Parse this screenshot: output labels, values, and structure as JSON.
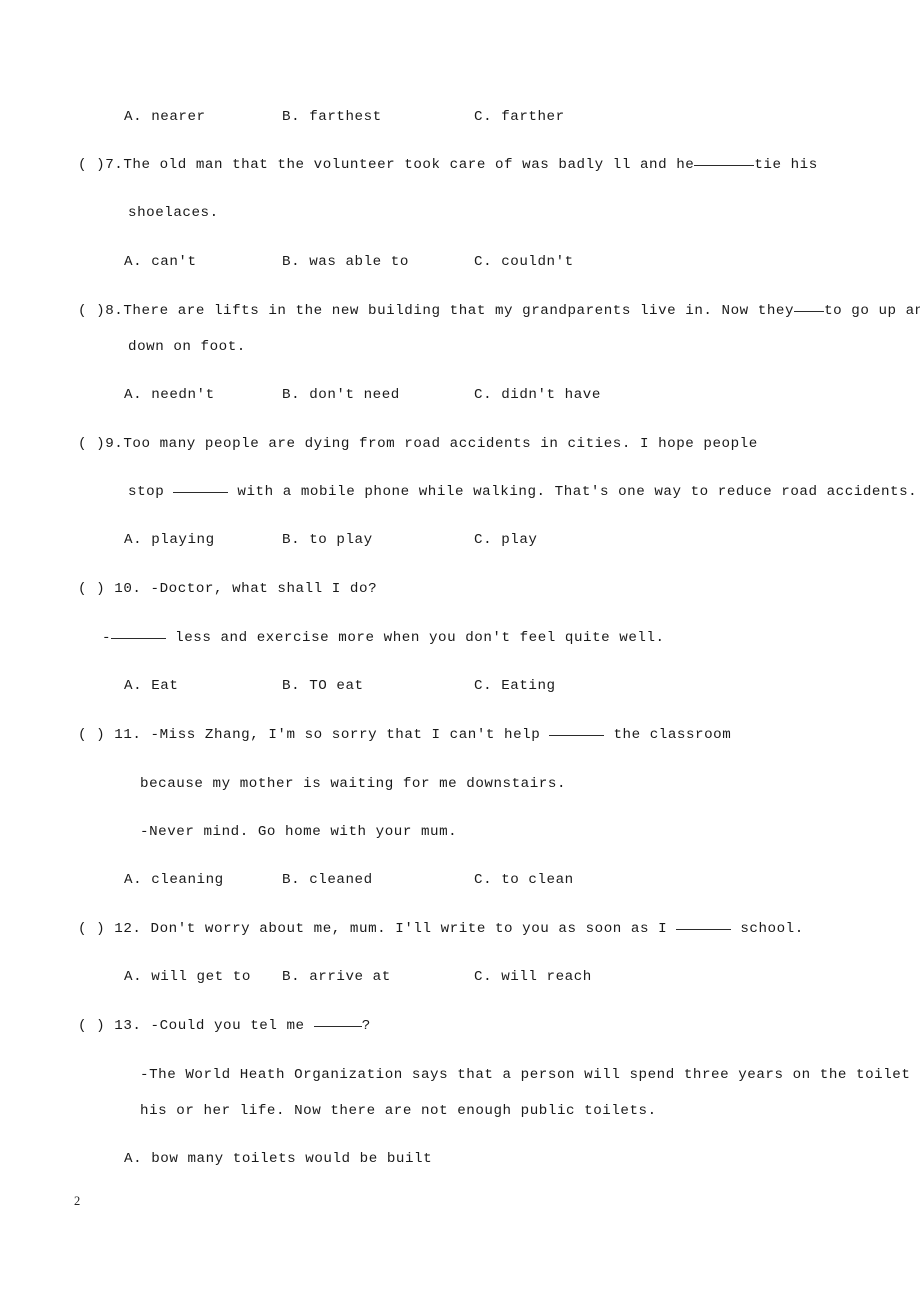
{
  "document": {
    "page_number": "2",
    "type": "english-exam-multiple-choice"
  },
  "orphan_options": {
    "a": "A. nearer",
    "b": "B. farthest",
    "c": "C. farther"
  },
  "questions": [
    {
      "marker": "(  )7.",
      "number": "7",
      "stem_parts": {
        "before_blank": "The old man that the volunteer took care of was badly ll and he",
        "after_blank": "tie his"
      },
      "continuation": "shoelaces.",
      "options": {
        "a": "A. can't",
        "b": "B. was able to",
        "c": "C. couldn't"
      }
    },
    {
      "marker": "(  )8.",
      "number": "8",
      "stem_parts": {
        "before_blank": "There are lifts in the new building that my grandparents live in. Now they",
        "after_blank": "to go up and"
      },
      "continuation": "down on foot.",
      "options": {
        "a": "A. needn't",
        "b": "B. don't need",
        "c": "C. didn't have"
      }
    },
    {
      "marker": "(  )9.",
      "number": "9",
      "stem_parts": {
        "before_blank": "Too many people are dying from road accidents in cities. I hope people",
        "after_blank": ""
      },
      "continuation_before_blank": "stop",
      "continuation_after_blank": "with a mobile phone while walking. That's one way to reduce road accidents.",
      "options": {
        "a": "A. playing",
        "b": "B. to play",
        "c": "C. play"
      }
    },
    {
      "marker": "(  ) 10.",
      "number": "10",
      "stem": "-Doctor, what shall I do?",
      "answer_line_prefix": "-",
      "answer_line_suffix": "less and exercise more when you don't feel quite well.",
      "options": {
        "a": "A. Eat",
        "b": "B. TO eat",
        "c": "C. Eating"
      }
    },
    {
      "marker": "(  ) 11.",
      "number": "11",
      "stem_parts": {
        "before_blank": "-Miss Zhang, I'm so sorry that I can't help",
        "after_blank": "the classroom"
      },
      "continuation": "because my mother is waiting for me downstairs.",
      "reply": "-Never mind. Go home with your mum.",
      "options": {
        "a": "A. cleaning",
        "b": "B. cleaned",
        "c": "C. to clean"
      }
    },
    {
      "marker": "(  ) 12.",
      "number": "12",
      "stem_parts": {
        "before_blank": "Don't worry about me, mum. I'll write to you as soon as I",
        "after_blank": "school."
      },
      "options": {
        "a": "A. will get to",
        "b": "B. arrive at",
        "c": "C. will reach"
      }
    },
    {
      "marker": "(  ) 13.",
      "number": "13",
      "stem_parts": {
        "before_blank": "-Could you tel me",
        "after_blank": "?"
      },
      "continuation": "-The World Heath Organization says that a person will spend three years on the toilet in",
      "continuation2": "his or her life. Now there are not enough public toilets.",
      "options": {
        "a": "A. bow many toilets would be built"
      }
    }
  ]
}
